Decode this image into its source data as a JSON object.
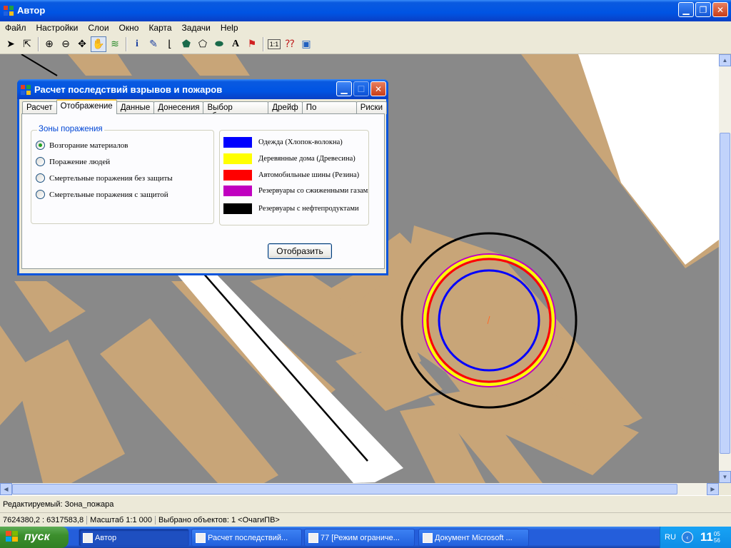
{
  "app": {
    "title": "Автор"
  },
  "menu": [
    "Файл",
    "Настройки",
    "Слои",
    "Окно",
    "Карта",
    "Задачи",
    "Help"
  ],
  "toolbar": {
    "tools": [
      "select-arrow-icon",
      "select-object-icon",
      "zoom-in-icon",
      "zoom-out-icon",
      "move-icon",
      "pan-hand-icon",
      "layers-icon",
      "info-icon",
      "pin-icon",
      "polyline-icon",
      "polygon-icon",
      "freeform-polygon-icon",
      "ellipse-icon",
      "text-icon",
      "flag-icon",
      "scale-icon",
      "query-icon",
      "image-icon"
    ]
  },
  "dialog": {
    "title": "Расчет последствий взрывов и пожаров",
    "tabs": [
      "Расчет",
      "Отображение",
      "Данные",
      "Донесения",
      "Выбор объекта",
      "Дрейф",
      "По площади",
      "Риски"
    ],
    "selected_tab": "Отображение",
    "zones_group_label": "Зоны поражения",
    "zones": [
      "Возгорание материалов",
      "Поражение людей",
      "Смертельные поражения без защиты",
      "Смертельные поражения с защитой"
    ],
    "selected_zone": "Возгорание материалов",
    "legend": [
      {
        "label": "Одежда (Хлопок-волокна)",
        "color": "#0000ff"
      },
      {
        "label": "Деревянные дома (Древесина)",
        "color": "#ffff00"
      },
      {
        "label": "Автомобильные шины (Резина)",
        "color": "#ff0000"
      },
      {
        "label": "Резервуары со сжиженными газами",
        "color": "#c000c0"
      },
      {
        "label": "Резервуары с нефтепродуктами",
        "color": "#000000"
      }
    ],
    "show_button": "Отобразить"
  },
  "status": {
    "editable": "Редактируемый: Зона_пожара",
    "coords": "7624380,2 : 6317583,8",
    "scale": "Масштаб 1:1 000",
    "selected": "Выбрано объектов: 1 <ОчагиПВ>"
  },
  "taskbar": {
    "start": "пуск",
    "tasks": [
      "Автор",
      "Расчет последствий...",
      "77 [Режим ограниче...",
      "Документ Microsoft ..."
    ],
    "lang": "RU",
    "time_hour": "11",
    "time_min": "05",
    "time_sec": "56"
  },
  "colors": {
    "map_bg": "#898989",
    "building": "#c8a578",
    "road": "#ffffff"
  }
}
